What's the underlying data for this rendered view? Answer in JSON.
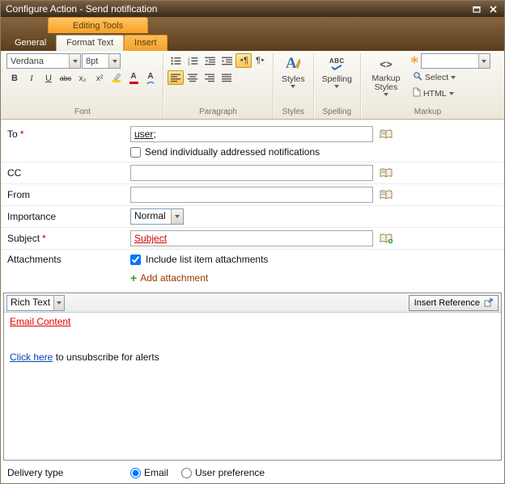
{
  "titlebar": {
    "title": "Configure Action - Send notification"
  },
  "ribbon": {
    "contextual_label": "Editing Tools",
    "tabs": {
      "general": "General",
      "format_text": "Format Text",
      "insert": "Insert"
    },
    "font": {
      "group_label": "Font",
      "font_name": "Verdana",
      "font_size": "8pt",
      "bold": "B",
      "italic": "I",
      "underline": "U",
      "strikethrough": "abc",
      "subscript": "x₂",
      "superscript": "x²"
    },
    "paragraph": {
      "group_label": "Paragraph"
    },
    "styles": {
      "group_label": "Styles",
      "button_label": "Styles"
    },
    "spelling": {
      "group_label": "Spelling",
      "button_label": "Spelling"
    },
    "markup": {
      "group_label": "Markup",
      "markup_styles_label": "Markup Styles",
      "select_label": "Select",
      "html_label": "HTML",
      "combo_value": ""
    }
  },
  "icons": {
    "pilcrow": "¶",
    "arrow_left": "◄",
    "arrow_right": "►",
    "font_color_letter": "A",
    "clear_format_letter": "A",
    "styles_letter": "A",
    "spelling_letters": "ABC",
    "markup_brackets": "<>",
    "numbering_digits": [
      "1",
      "2",
      "3"
    ],
    "add_plus": "+"
  },
  "form": {
    "to": {
      "label": "To",
      "required_mark": "*",
      "value": "user",
      "value_suffix": " ;",
      "checkbox_label": "Send individually addressed notifications",
      "checkbox_checked": false
    },
    "cc": {
      "label": "CC",
      "value": ""
    },
    "from": {
      "label": "From",
      "value": ""
    },
    "importance": {
      "label": "Importance",
      "value": "Normal"
    },
    "subject": {
      "label": "Subject",
      "required_mark": "*",
      "value": "Subject"
    },
    "attachments": {
      "label": "Attachments",
      "checkbox_label": "Include list item attachments",
      "checkbox_checked": true,
      "add_attachment_label": "Add attachment"
    },
    "editor": {
      "mode_value": "Rich Text",
      "insert_reference_label": "Insert Reference",
      "content_heading": "Email Content",
      "unsubscribe_link": "Click here",
      "unsubscribe_rest": " to unsubscribe for alerts"
    },
    "delivery": {
      "label": "Delivery type",
      "email_option": "Email",
      "email_selected": true,
      "user_pref_option": "User preference",
      "user_pref_selected": false
    }
  },
  "colors": {
    "accent_orange": "#f8a126",
    "titlebar_brown": "#3b2a17",
    "required_red": "#c00000",
    "link_blue": "#0645ad"
  }
}
